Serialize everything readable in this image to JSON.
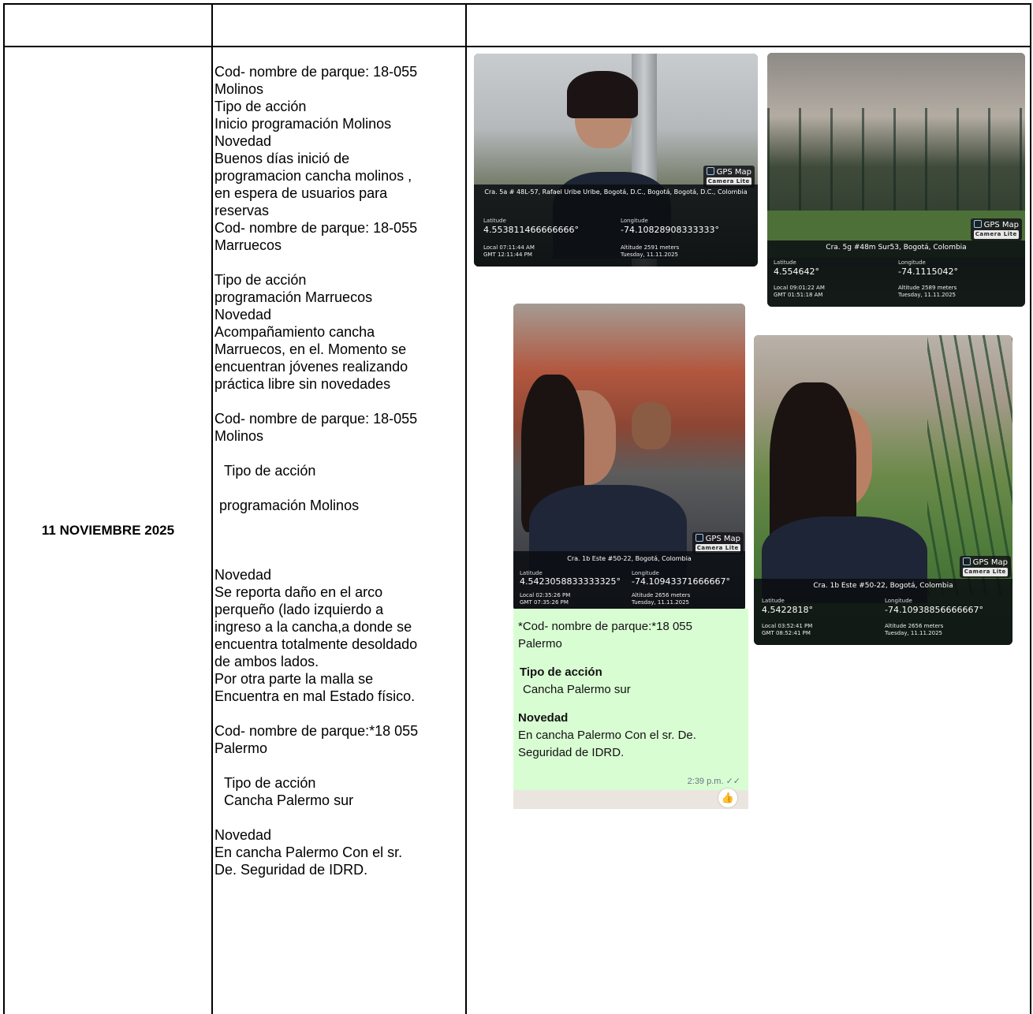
{
  "date": "11 NOVIEMBRE 2025",
  "report": [
    "Cod- nombre de parque: 18-055",
    "Molinos",
    "Tipo de acción",
    "Inicio programación Molinos",
    "Novedad",
    "Buenos días inició de",
    "programacion cancha molinos ,",
    "en espera de usuarios para",
    "reservas",
    "Cod- nombre de parque: 18-055",
    "Marruecos",
    "Tipo de acción",
    "programación Marruecos",
    "Novedad",
    "Acompañamiento cancha",
    "Marruecos, en el. Momento se",
    "encuentran jóvenes realizando",
    "práctica libre sin novedades",
    "Cod- nombre de parque: 18-055",
    "Molinos",
    "Tipo de acción",
    "programación Molinos",
    "Novedad",
    "Se reporta daño en el arco",
    "perqueño (lado izquierdo a",
    "ingreso a la cancha,a donde se",
    "encuentra totalmente desoldado",
    "de ambos lados.",
    "Por otra parte la malla se",
    "Encuentra en mal Estado físico.",
    "Cod- nombre de parque:*18 055",
    "Palermo",
    "Tipo de acción",
    "Cancha Palermo sur",
    "Novedad",
    "En cancha Palermo Con el sr.",
    "De. Seguridad de IDRD."
  ],
  "photos": [
    {
      "badge": "GPS Map",
      "badge_sub": "Camera Lite",
      "address": "Cra. 5a # 48L-57, Rafael Uribe Uribe, Bogotá, D.C., Bogotá, Bogotá, D.C., Colombia",
      "lat_label": "Latitude",
      "lat": "4.553811466666666°",
      "lon_label": "Longitude",
      "lon": "-74.10828908333333°",
      "local": "Local 07:11:44 AM",
      "gmt": "GMT 12:11:44 PM",
      "altitude": "Altitude 2591 meters",
      "day": "Tuesday, 11.11.2025"
    },
    {
      "badge": "GPS Map",
      "badge_sub": "Camera Lite",
      "address": "Cra. 5g #48m Sur53, Bogotá, Colombia",
      "lat_label": "Latitude",
      "lat": "4.554642°",
      "lon_label": "Longitude",
      "lon": "-74.1115042°",
      "local": "Local 09:01:22 AM",
      "gmt": "GMT 01:51:18 AM",
      "altitude": "Altitude 2589 meters",
      "day": "Tuesday, 11.11.2025"
    },
    {
      "badge": "GPS Map",
      "badge_sub": "Camera Lite",
      "address": "Cra. 1b Este #50-22, Bogotá, Colombia",
      "lat_label": "Latitude",
      "lat": "4.5423058833333325°",
      "lon_label": "Longitude",
      "lon": "-74.10943371666667°",
      "local": "Local 02:35:26 PM",
      "gmt": "GMT 07:35:26 PM",
      "altitude": "Altitude 2656 meters",
      "day": "Tuesday, 11.11.2025"
    },
    {
      "badge": "GPS Map",
      "badge_sub": "Camera Lite",
      "address": "Cra. 1b Este #50-22, Bogotá, Colombia",
      "lat_label": "Latitude",
      "lat": "4.5422818°",
      "lon_label": "Longitude",
      "lon": "-74.10938856666667°",
      "local": "Local 03:52:41 PM",
      "gmt": "GMT 08:52:41 PM",
      "altitude": "Altitude 2656 meters",
      "day": "Tuesday, 11.11.2025"
    }
  ],
  "chat": {
    "line1": "*Cod- nombre de parque:*18 055",
    "line2": "Palermo",
    "tipo_title": "Tipo de acción",
    "tipo_value": "Cancha Palermo sur",
    "novedad_title": "Novedad",
    "novedad_1": "En cancha Palermo Con el sr. De.",
    "novedad_2": "Seguridad de IDRD.",
    "time": "2:39 p.m.",
    "ticks": "✓✓",
    "reaction": "👍"
  },
  "colors": {
    "chat_bg": "#d9fdd3",
    "infobar": "#0a0e12"
  }
}
